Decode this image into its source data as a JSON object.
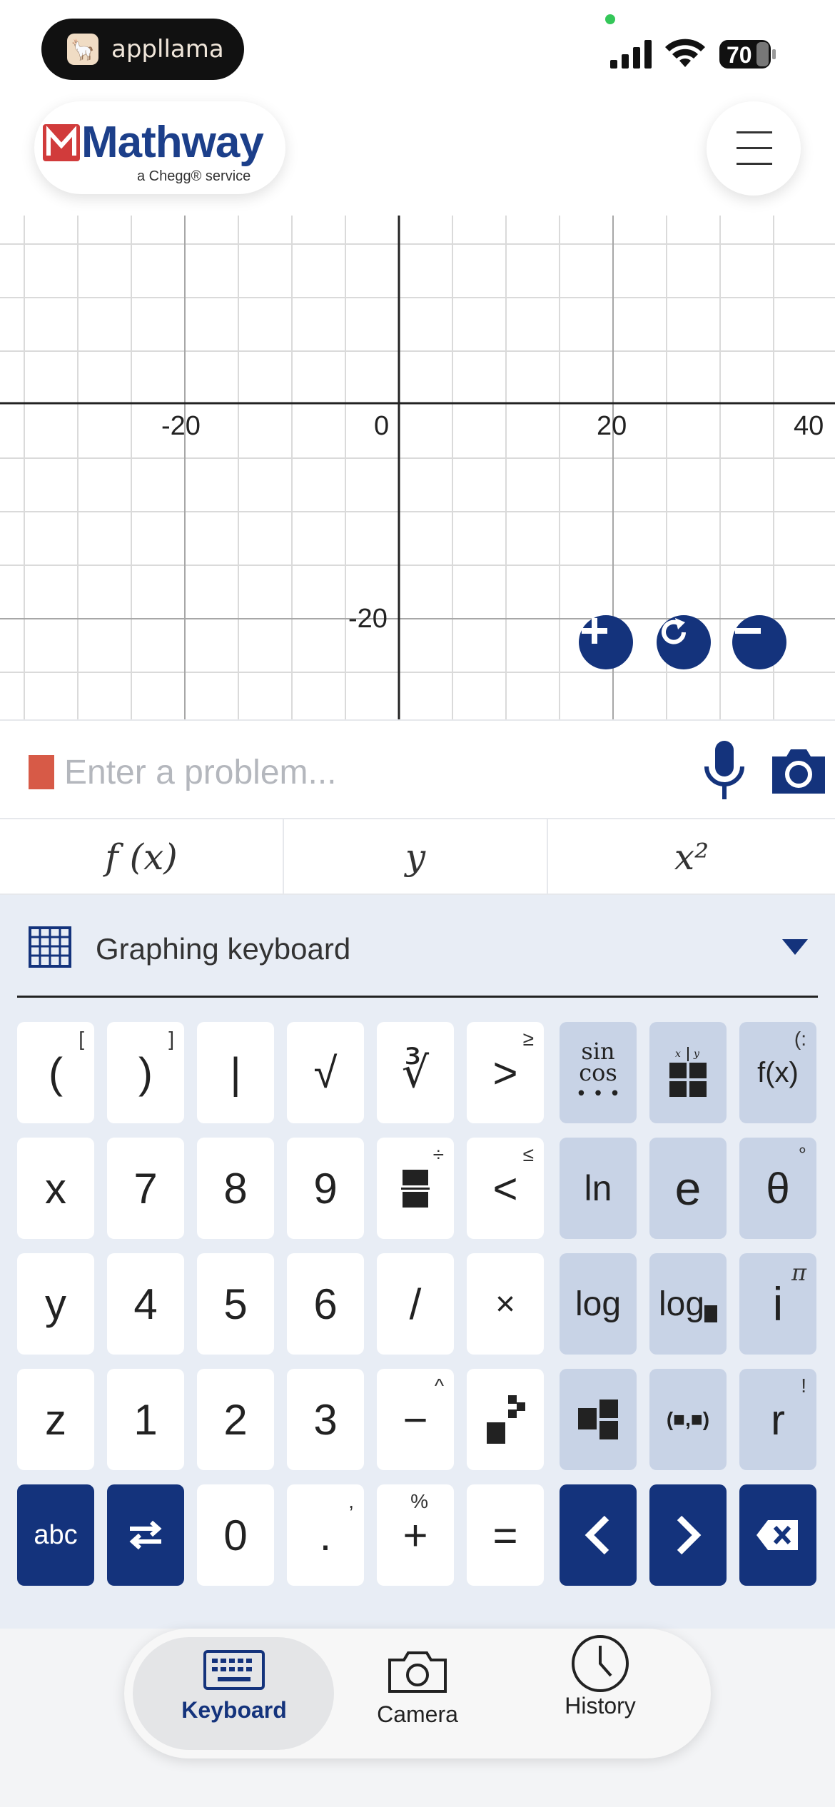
{
  "status_bar": {
    "app_pill_label": "appllama",
    "battery": "70"
  },
  "header": {
    "logo_text": "Mathway",
    "logo_subtitle": "a Chegg® service"
  },
  "graph": {
    "x_ticks": [
      "-20",
      "0",
      "20",
      "40"
    ],
    "y_ticks": [
      "-20"
    ]
  },
  "input": {
    "placeholder": "Enter a problem..."
  },
  "quick_tabs": [
    "f (x)",
    "y",
    "x²"
  ],
  "keyboard": {
    "title": "Graphing keyboard",
    "rows": [
      [
        "(",
        ")",
        "|",
        "√",
        "∛",
        ">",
        "sin cos",
        "table",
        "f(x)"
      ],
      [
        "x",
        "7",
        "8",
        "9",
        "frac",
        "<",
        "ln",
        "e",
        "θ"
      ],
      [
        "y",
        "4",
        "5",
        "6",
        "/",
        "×",
        "log",
        "log_",
        "i"
      ],
      [
        "z",
        "1",
        "2",
        "3",
        "−",
        "power",
        "matrix",
        "(■,■)",
        "r"
      ],
      [
        "abc",
        "swap",
        "0",
        ".",
        "+",
        "=",
        "left",
        "right",
        "backspace"
      ]
    ],
    "superscripts": {
      "open_paren": "[",
      "close_paren": "]",
      "greater": "≥",
      "less": "≤",
      "frac": "÷",
      "theta": "°",
      "i": "π",
      "minus": "^",
      "r": "!",
      "dot": ",",
      "plus": "%"
    }
  },
  "bottom_nav": {
    "items": [
      {
        "label": "Keyboard",
        "active": true
      },
      {
        "label": "Camera",
        "active": false
      },
      {
        "label": "History",
        "active": false
      }
    ]
  },
  "colors": {
    "brand_navy": "#14337c",
    "function_key": "#c8d3e6",
    "cursor": "#d75a47"
  }
}
